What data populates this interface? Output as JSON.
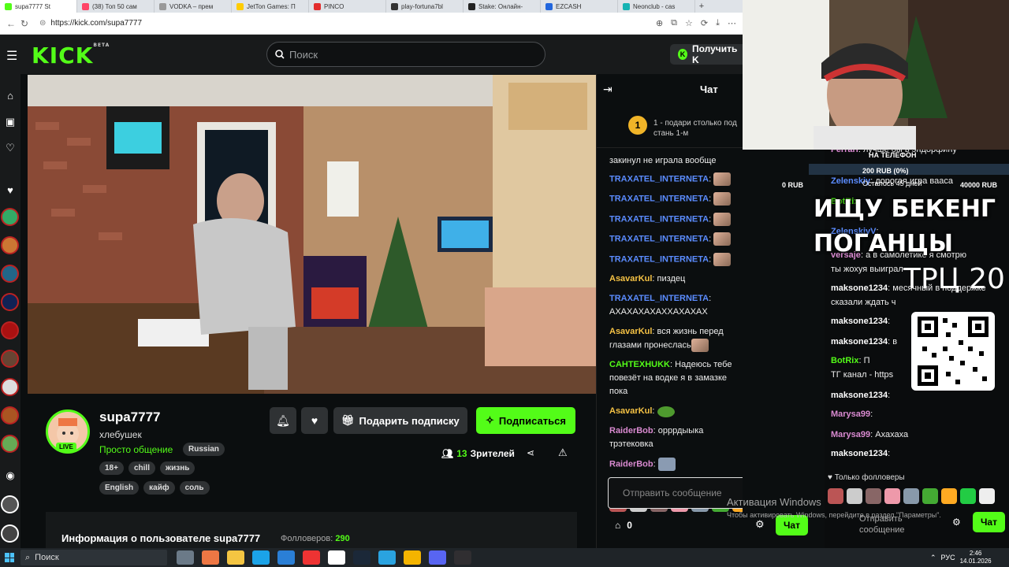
{
  "browser": {
    "tabs": [
      {
        "label": "supa7777 St",
        "color": "#53fc18",
        "active": true
      },
      {
        "label": "(38) Топ 50 сам",
        "color": "#ff4466"
      },
      {
        "label": "VODKA – прем",
        "color": "#999999"
      },
      {
        "label": "JetTon Games: П",
        "color": "#ffcc00"
      },
      {
        "label": "PINCO",
        "color": "#e32d2d"
      },
      {
        "label": "play-fortuna7bl",
        "color": "#333333"
      },
      {
        "label": "Stake: Онлайн-",
        "color": "#222222"
      },
      {
        "label": "EZCASH",
        "color": "#2266dd"
      },
      {
        "label": "Neonclub - cas",
        "color": "#16b3b3"
      }
    ],
    "new_tab": "+",
    "url": "https://kick.com/supa7777"
  },
  "nav": {
    "logo": "KICK",
    "logo_badge": "BETA",
    "search_placeholder": "Поиск",
    "get_button": "Получить K"
  },
  "channel": {
    "name": "supa7777",
    "subtitle": "хлебушек",
    "category": "Просто общение",
    "language": "Russian",
    "live_label": "LIVE",
    "tags_row1": [
      "18+",
      "chill",
      "жизнь"
    ],
    "tags_row2": [
      "English",
      "кайф",
      "соль"
    ],
    "gift_sub": "Подарить подписку",
    "subscribe": "Подписаться",
    "viewers_count": "13",
    "viewers_label": "Зрителей",
    "about_title": "Информация о пользователе supa7777",
    "followers_label": "Фолловеров:",
    "followers_count": "290"
  },
  "chat": {
    "title": "Чат",
    "pinned_number": "1",
    "pinned_text": "1 - подари столько под стань 1-м",
    "input_placeholder": "Отправить сообщение",
    "points": "0",
    "send": "Чат",
    "messages": [
      {
        "user": "",
        "color": "#eeeeee",
        "text": "закинул не играла вообще",
        "emote": ""
      },
      {
        "user": "TRAXATEL_INTERNETA",
        "color": "#5b8cff",
        "text": "",
        "emote": "face"
      },
      {
        "user": "TRAXATEL_INTERNETA",
        "color": "#5b8cff",
        "text": "",
        "emote": "face"
      },
      {
        "user": "TRAXATEL_INTERNETA",
        "color": "#5b8cff",
        "text": "",
        "emote": "face"
      },
      {
        "user": "TRAXATEL_INTERNETA",
        "color": "#5b8cff",
        "text": "",
        "emote": "face"
      },
      {
        "user": "TRAXATEL_INTERNETA",
        "color": "#5b8cff",
        "text": "",
        "emote": "face"
      },
      {
        "user": "AsavarKul",
        "color": "#f5c244",
        "text": "пиздец",
        "emote": ""
      },
      {
        "user": "TRAXATEL_INTERNETA",
        "color": "#5b8cff",
        "text": "АХАХАХАХАХХАХАХАХ",
        "emote": ""
      },
      {
        "user": "AsavarKul",
        "color": "#f5c244",
        "text": "вся жизнь перед глазами пронеслась",
        "emote": "face"
      },
      {
        "user": "CAHTEXHUKK",
        "color": "#53fc18",
        "text": "Надеюсь тебе повезёт на водке я в замазке пока",
        "emote": ""
      },
      {
        "user": "AsavarKul",
        "color": "#f5c244",
        "text": "",
        "emote": "pepe"
      },
      {
        "user": "RaiderBob",
        "color": "#d98ad0",
        "text": "орррдыыка трэтековка",
        "emote": ""
      },
      {
        "user": "RaiderBob",
        "color": "#d98ad0",
        "text": "",
        "emote": "pig"
      }
    ]
  },
  "overlay": {
    "goal_title": "НА ТЕЛЕФОН",
    "goal_amount": "200 RUB (0%)",
    "goal_progress": 0,
    "goal_start": "0 RUB",
    "goal_end": "40000 RUB",
    "goal_days": "Осталось 45 дней",
    "big_text_1": "ИЩУ БЕКЕНГ",
    "big_text_2": "ПОГАНЦЫ",
    "trc": "ТРЦ 20",
    "messages": [
      {
        "user": "Ferrari",
        "text": "лучше бы в эндорфину",
        "cls": "pink"
      },
      {
        "user": "Zelenskiy",
        "text": "дорогая игра вааса",
        "cls": "blue"
      },
      {
        "user": "BotRix",
        "text": "",
        "cls": "green"
      },
      {
        "user": "ZelenskiyV",
        "text": "",
        "cls": "blue"
      },
      {
        "user": "versaje",
        "text": "а в самолетике я смотрю",
        "cls": "pink"
      },
      {
        "user": "",
        "text": "ты жохуя выиграл",
        "cls": ""
      },
      {
        "user": "maksone1234",
        "text": "месячный в поддержке",
        "cls": ""
      },
      {
        "user": "",
        "text": "сказали ждать ч",
        "cls": ""
      },
      {
        "user": "maksone1234",
        "text": "",
        "cls": ""
      },
      {
        "user": "maksone1234",
        "text": "в",
        "cls": ""
      },
      {
        "user": "BotRix",
        "text": "П",
        "cls": "green"
      },
      {
        "user": "",
        "text": "ТГ канал - https",
        "cls": ""
      },
      {
        "user": "maksone1234",
        "text": "",
        "cls": ""
      },
      {
        "user": "Marysa99",
        "text": "",
        "cls": "pink"
      },
      {
        "user": "Marysa99",
        "text": "Ахахаха",
        "cls": "pink"
      },
      {
        "user": "maksone1234",
        "text": "",
        "cls": ""
      }
    ],
    "followers_only": "Только фолловеры",
    "input_text": "Отправить сообщение",
    "send": "Чат"
  },
  "activation": {
    "title": "Активация Windows",
    "subtitle": "Чтобы активировать Windows, перейдите в раздел \"Параметры\"."
  },
  "taskbar": {
    "search": "Поиск",
    "lang": "РУС",
    "time": "2:46",
    "date": "14.01.2026"
  }
}
